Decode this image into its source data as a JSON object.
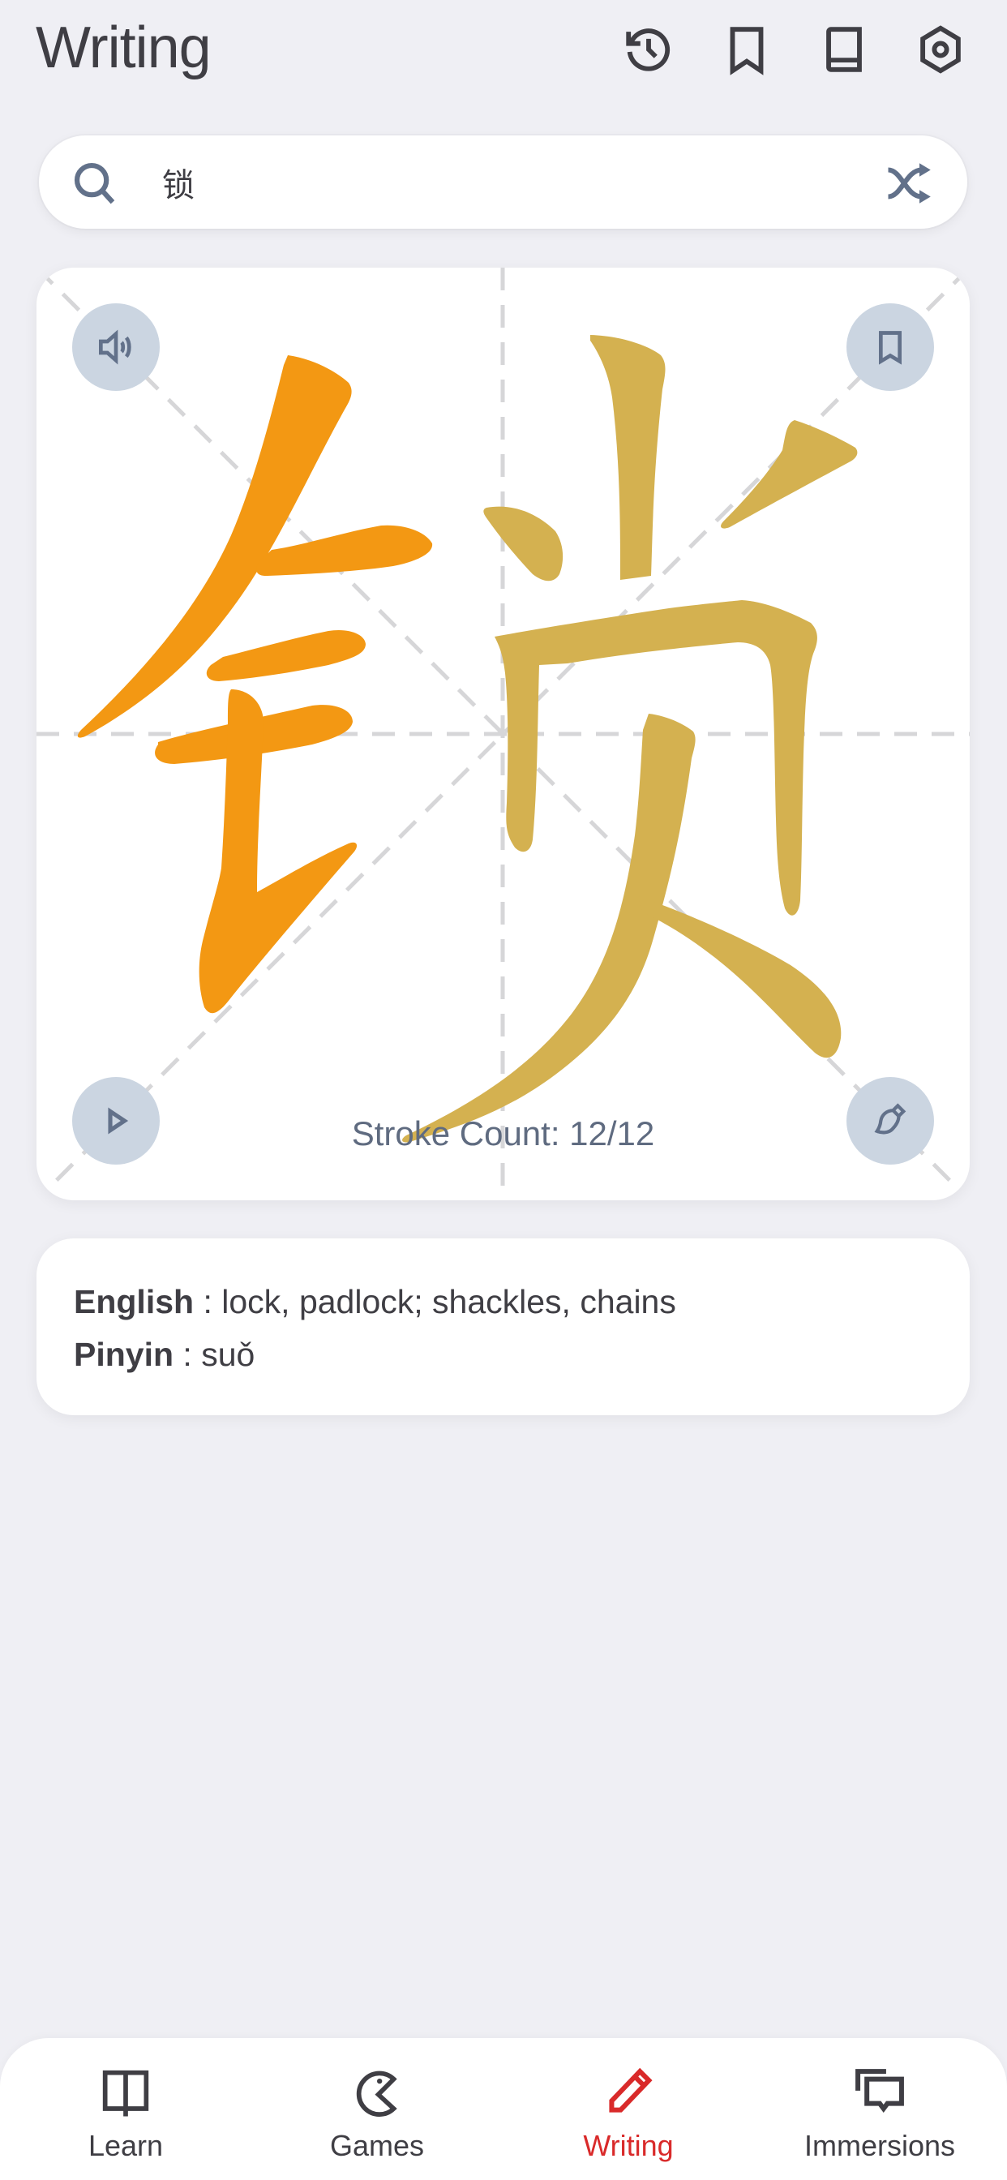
{
  "header": {
    "title": "Writing",
    "icons": [
      "history-icon",
      "bookmark-icon",
      "book-icon",
      "settings-icon"
    ]
  },
  "search": {
    "value": "锁",
    "placeholder": "Search",
    "left_icon": "search-icon",
    "right_icon": "shuffle-icon"
  },
  "character_card": {
    "character": "锁",
    "stroke_count_label": "Stroke Count: 12/12",
    "strokes_completed": 12,
    "strokes_total": 12,
    "buttons": {
      "top_left": "speaker-icon",
      "top_right": "bookmark-icon",
      "bottom_left": "play-icon",
      "bottom_right": "brush-icon"
    },
    "colors": {
      "radical": "#F39813",
      "component": "#D4B150",
      "guide_lines": "#d6d6d8",
      "button_bg": "#cbd5e1"
    }
  },
  "info": {
    "english_label": "English",
    "english_value": " : lock, padlock; shackles, chains",
    "pinyin_label": "Pinyin",
    "pinyin_value": " : suǒ"
  },
  "bottom_nav": {
    "active_color": "#d92a2a",
    "items": [
      {
        "label": "Learn",
        "icon": "open-book-icon",
        "active": false
      },
      {
        "label": "Games",
        "icon": "pacman-icon",
        "active": false
      },
      {
        "label": "Writing",
        "icon": "pencil-icon",
        "active": true
      },
      {
        "label": "Immersions",
        "icon": "chat-bubbles-icon",
        "active": false
      }
    ]
  }
}
